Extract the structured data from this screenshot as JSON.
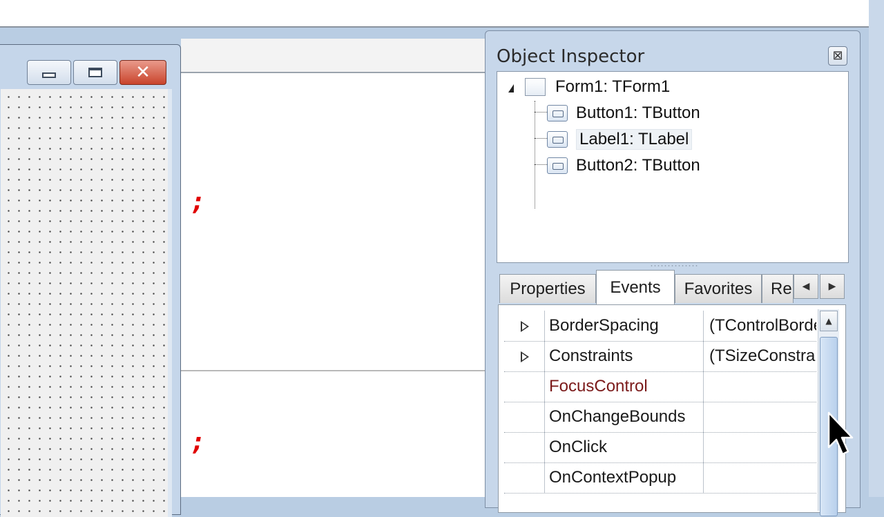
{
  "object_inspector": {
    "title": "Object Inspector",
    "close_glyph": "⊠",
    "tree": [
      {
        "label": "Form1: TForm1",
        "icon": "form-icon"
      },
      {
        "label": "Button1: TButton",
        "icon": "button-component-icon"
      },
      {
        "label": "Label1: TLabel",
        "icon": "label-component-icon",
        "selected": true
      },
      {
        "label": "Button2: TButton",
        "icon": "button-component-icon"
      }
    ],
    "tabs": [
      "Properties",
      "Events",
      "Favorites",
      "Re"
    ],
    "active_tab": "Events",
    "tab_scroll_left": "◀",
    "tab_scroll_right": "▶",
    "properties": [
      {
        "name": "BorderSpacing",
        "value": "(TControlBorderSpacing)",
        "expandable": true
      },
      {
        "name": "Constraints",
        "value": "(TSizeConstraints)",
        "expandable": true
      },
      {
        "name": "FocusControl",
        "value": "",
        "highlight_color": "#7b1a1a"
      },
      {
        "name": "OnChangeBounds",
        "value": ""
      },
      {
        "name": "OnClick",
        "value": ""
      },
      {
        "name": "OnContextPopup",
        "value": ""
      }
    ],
    "scroll_up_glyph": "▲"
  },
  "form_window": {
    "minimize_glyph": "minimize-icon",
    "maximize_glyph": "maximize-icon",
    "close_glyph": "✕"
  },
  "editor": {
    "markers": [
      ";",
      ";"
    ],
    "marker_color": "#e10000"
  }
}
